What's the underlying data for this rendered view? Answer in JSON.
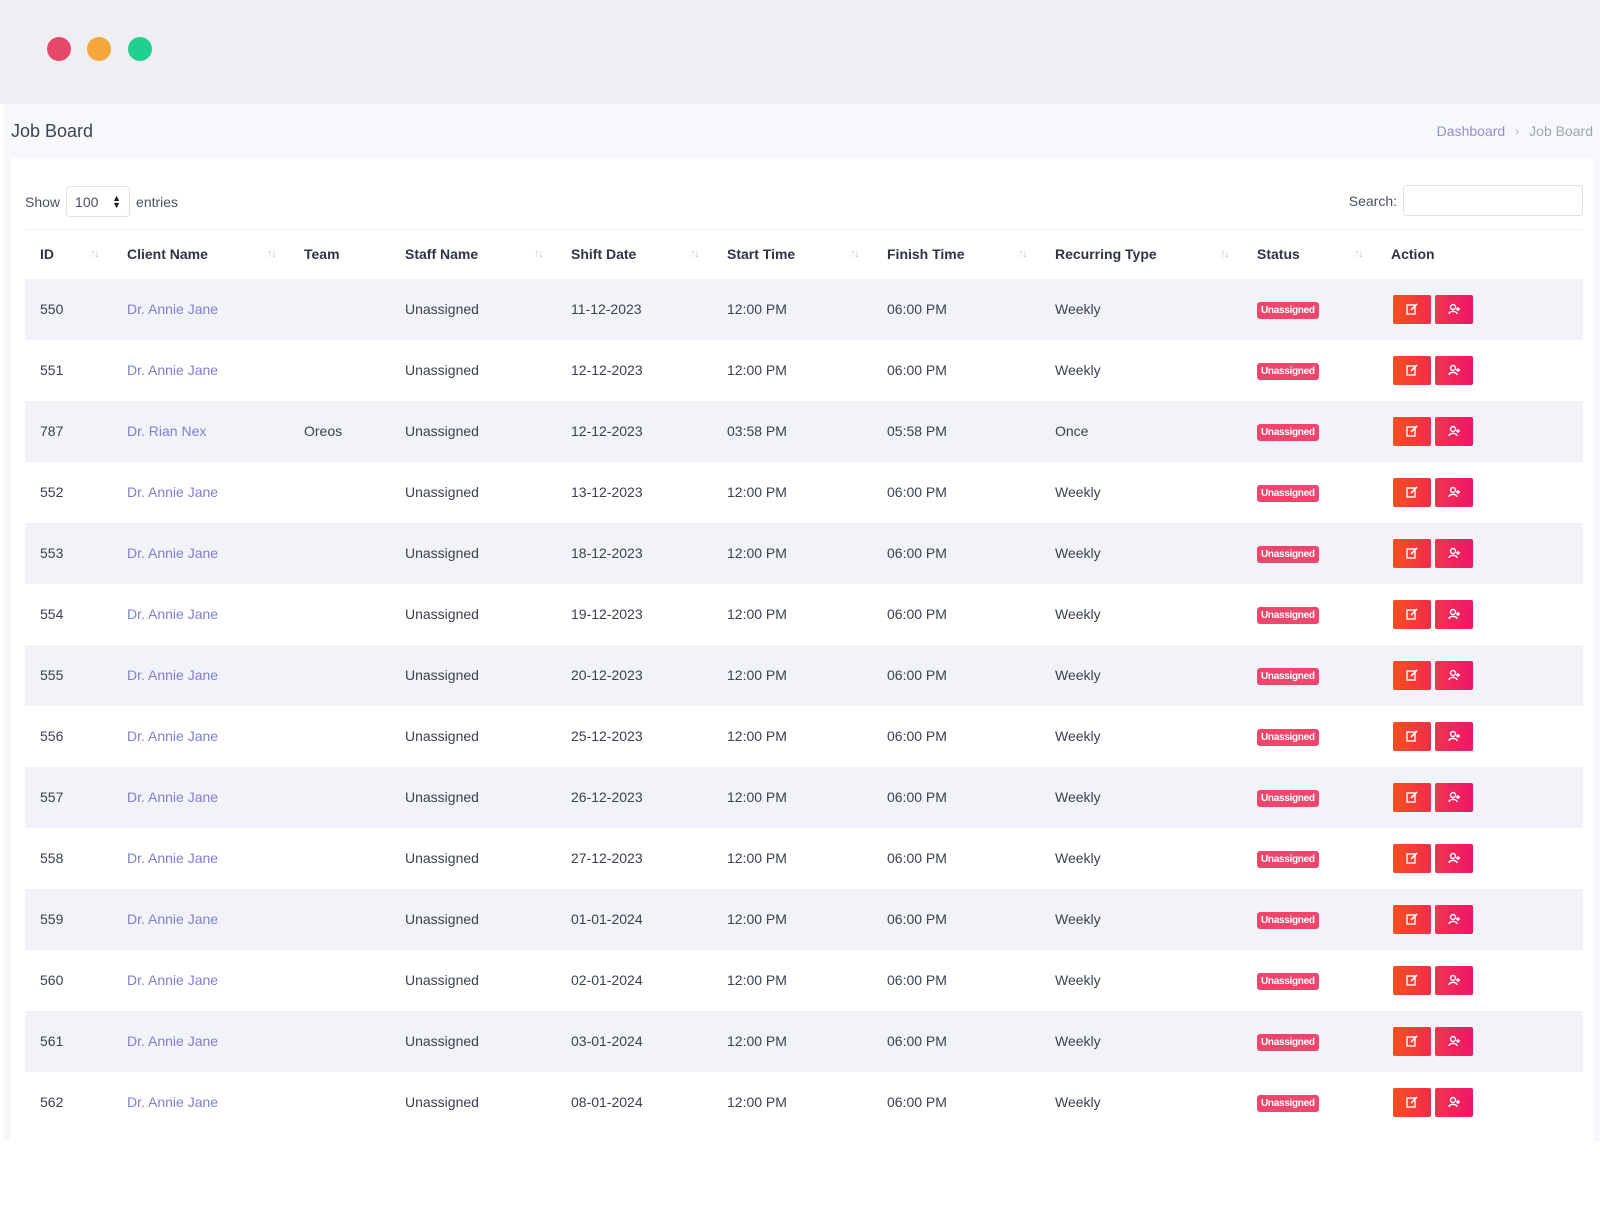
{
  "window_controls": [
    "close",
    "minimize",
    "maximize"
  ],
  "page": {
    "title": "Job Board",
    "breadcrumb": {
      "home": "Dashboard",
      "separator": "›",
      "current": "Job Board"
    }
  },
  "table_controls": {
    "show_label": "Show",
    "entries_value": "100",
    "entries_label": "entries",
    "search_label": "Search:",
    "search_value": ""
  },
  "columns": [
    "ID",
    "Client Name",
    "Team",
    "Staff Name",
    "Shift Date",
    "Start Time",
    "Finish Time",
    "Recurring Type",
    "Status",
    "Action"
  ],
  "rows": [
    {
      "id": "550",
      "client": "Dr. Annie Jane",
      "team": "",
      "staff": "Unassigned",
      "date": "11-12-2023",
      "start": "12:00 PM",
      "finish": "06:00 PM",
      "recurring": "Weekly",
      "status": "Unassigned"
    },
    {
      "id": "551",
      "client": "Dr. Annie Jane",
      "team": "",
      "staff": "Unassigned",
      "date": "12-12-2023",
      "start": "12:00 PM",
      "finish": "06:00 PM",
      "recurring": "Weekly",
      "status": "Unassigned"
    },
    {
      "id": "787",
      "client": "Dr. Rian Nex",
      "team": "Oreos",
      "staff": "Unassigned",
      "date": "12-12-2023",
      "start": "03:58 PM",
      "finish": "05:58 PM",
      "recurring": "Once",
      "status": "Unassigned"
    },
    {
      "id": "552",
      "client": "Dr. Annie Jane",
      "team": "",
      "staff": "Unassigned",
      "date": "13-12-2023",
      "start": "12:00 PM",
      "finish": "06:00 PM",
      "recurring": "Weekly",
      "status": "Unassigned"
    },
    {
      "id": "553",
      "client": "Dr. Annie Jane",
      "team": "",
      "staff": "Unassigned",
      "date": "18-12-2023",
      "start": "12:00 PM",
      "finish": "06:00 PM",
      "recurring": "Weekly",
      "status": "Unassigned"
    },
    {
      "id": "554",
      "client": "Dr. Annie Jane",
      "team": "",
      "staff": "Unassigned",
      "date": "19-12-2023",
      "start": "12:00 PM",
      "finish": "06:00 PM",
      "recurring": "Weekly",
      "status": "Unassigned"
    },
    {
      "id": "555",
      "client": "Dr. Annie Jane",
      "team": "",
      "staff": "Unassigned",
      "date": "20-12-2023",
      "start": "12:00 PM",
      "finish": "06:00 PM",
      "recurring": "Weekly",
      "status": "Unassigned"
    },
    {
      "id": "556",
      "client": "Dr. Annie Jane",
      "team": "",
      "staff": "Unassigned",
      "date": "25-12-2023",
      "start": "12:00 PM",
      "finish": "06:00 PM",
      "recurring": "Weekly",
      "status": "Unassigned"
    },
    {
      "id": "557",
      "client": "Dr. Annie Jane",
      "team": "",
      "staff": "Unassigned",
      "date": "26-12-2023",
      "start": "12:00 PM",
      "finish": "06:00 PM",
      "recurring": "Weekly",
      "status": "Unassigned"
    },
    {
      "id": "558",
      "client": "Dr. Annie Jane",
      "team": "",
      "staff": "Unassigned",
      "date": "27-12-2023",
      "start": "12:00 PM",
      "finish": "06:00 PM",
      "recurring": "Weekly",
      "status": "Unassigned"
    },
    {
      "id": "559",
      "client": "Dr. Annie Jane",
      "team": "",
      "staff": "Unassigned",
      "date": "01-01-2024",
      "start": "12:00 PM",
      "finish": "06:00 PM",
      "recurring": "Weekly",
      "status": "Unassigned"
    },
    {
      "id": "560",
      "client": "Dr. Annie Jane",
      "team": "",
      "staff": "Unassigned",
      "date": "02-01-2024",
      "start": "12:00 PM",
      "finish": "06:00 PM",
      "recurring": "Weekly",
      "status": "Unassigned"
    },
    {
      "id": "561",
      "client": "Dr. Annie Jane",
      "team": "",
      "staff": "Unassigned",
      "date": "03-01-2024",
      "start": "12:00 PM",
      "finish": "06:00 PM",
      "recurring": "Weekly",
      "status": "Unassigned"
    },
    {
      "id": "562",
      "client": "Dr. Annie Jane",
      "team": "",
      "staff": "Unassigned",
      "date": "08-01-2024",
      "start": "12:00 PM",
      "finish": "06:00 PM",
      "recurring": "Weekly",
      "status": "Unassigned"
    }
  ],
  "icons": {
    "sort": "sort-arrows-icon",
    "edit": "edit-icon",
    "assign": "assign-user-icon",
    "select": "select-arrows-icon"
  },
  "colors": {
    "link": "#7d80cf",
    "status_badge": "#f0466d",
    "edit_button": "#f54f1f",
    "assign_button": "#ee1768",
    "striped_row": "#f2f3f8"
  }
}
